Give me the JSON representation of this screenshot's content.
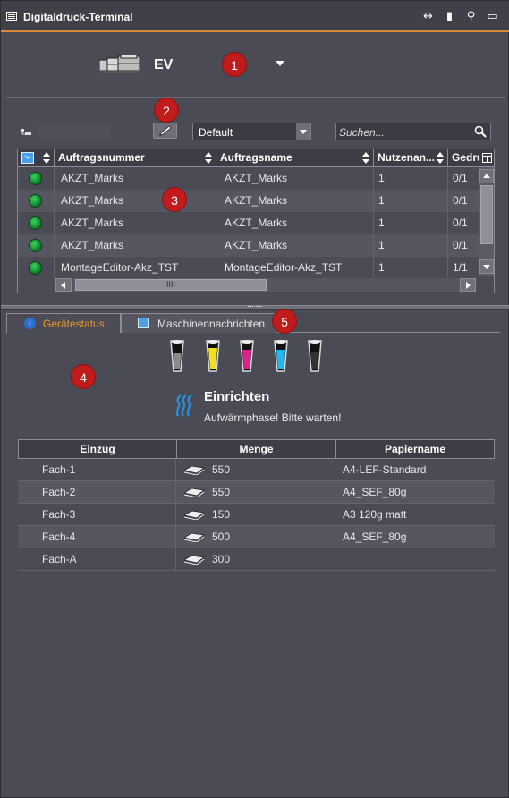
{
  "app": {
    "title": "Digitaldruck-Terminal"
  },
  "device": {
    "name": "EV"
  },
  "callouts": [
    "1",
    "2",
    "3",
    "4",
    "5"
  ],
  "toolbar": {
    "queue_select": "Default",
    "search_placeholder": "Suchen..."
  },
  "jobs": {
    "columns": [
      "Auftragsnummer",
      "Auftragsname",
      "Nutzenan...",
      "Gedru"
    ],
    "rows": [
      {
        "number": "AKZT_Marks",
        "name": "AKZT_Marks",
        "nutzen": "1",
        "printed": "0/1"
      },
      {
        "number": "AKZT_Marks",
        "name": "AKZT_Marks",
        "nutzen": "1",
        "printed": "0/1"
      },
      {
        "number": "AKZT_Marks",
        "name": "AKZT_Marks",
        "nutzen": "1",
        "printed": "0/1"
      },
      {
        "number": "AKZT_Marks",
        "name": "AKZT_Marks",
        "nutzen": "1",
        "printed": "0/1"
      },
      {
        "number": "MontageEditor-Akz_TST",
        "name": "MontageEditor-Akz_TST",
        "nutzen": "1",
        "printed": "1/1"
      }
    ]
  },
  "tabs": [
    {
      "label": "Gerätestatus",
      "active": true
    },
    {
      "label": "Maschinennachrichten",
      "active": false
    }
  ],
  "toners": [
    "#8a8a8a",
    "#f0e020",
    "#e0208c",
    "#20b8f0",
    "#2a2a2a"
  ],
  "status": {
    "title": "Einrichten",
    "message": "Aufwärmphase! Bitte warten!"
  },
  "trays": {
    "columns": [
      "Einzug",
      "Menge",
      "Papiername"
    ],
    "rows": [
      {
        "tray": "Fach-1",
        "amount": "550",
        "paper": "A4-LEF-Standard"
      },
      {
        "tray": "Fach-2",
        "amount": "550",
        "paper": "A4_SEF_80g"
      },
      {
        "tray": "Fach-3",
        "amount": "150",
        "paper": "A3 120g matt"
      },
      {
        "tray": "Fach-4",
        "amount": "500",
        "paper": "A4_SEF_80g"
      },
      {
        "tray": "Fach-A",
        "amount": "300",
        "paper": ""
      }
    ]
  },
  "colors": {
    "accent": "#d9893a",
    "active_tab": "#e89a2e",
    "callout": "#c21b1b",
    "status_ok": "#1fa83f"
  }
}
